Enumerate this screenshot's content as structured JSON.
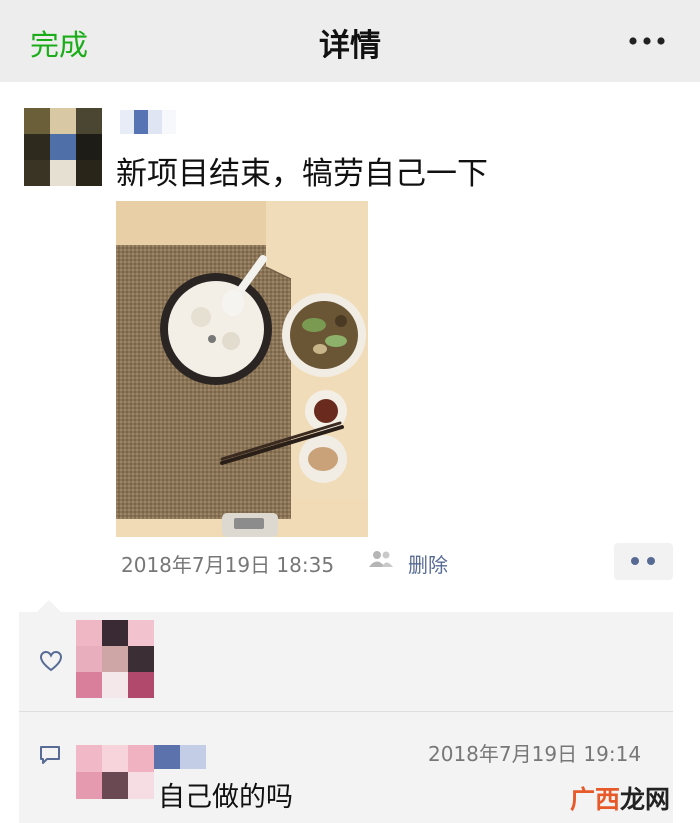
{
  "header": {
    "done_label": "完成",
    "title": "详情",
    "more_icon": "more-dots-icon"
  },
  "post": {
    "text": "新项目结束，犒劳自己一下",
    "timestamp": "2018年7月19日 18:35",
    "delete_label": "删除",
    "visibility_icon": "people-icon",
    "actions_icon": "two-dots-icon"
  },
  "likes": {
    "icon": "heart-icon"
  },
  "comments": [
    {
      "time": "2018年7月19日 19:14",
      "text": "自己做的吗",
      "icon": "comment-bubble-icon"
    }
  ],
  "watermark": {
    "part1": "广西",
    "part2": "龙网"
  },
  "colors": {
    "accent_green": "#1aad19",
    "link_blue": "#576b95",
    "header_bg": "#ededed",
    "panel_bg": "#f3f3f3"
  }
}
